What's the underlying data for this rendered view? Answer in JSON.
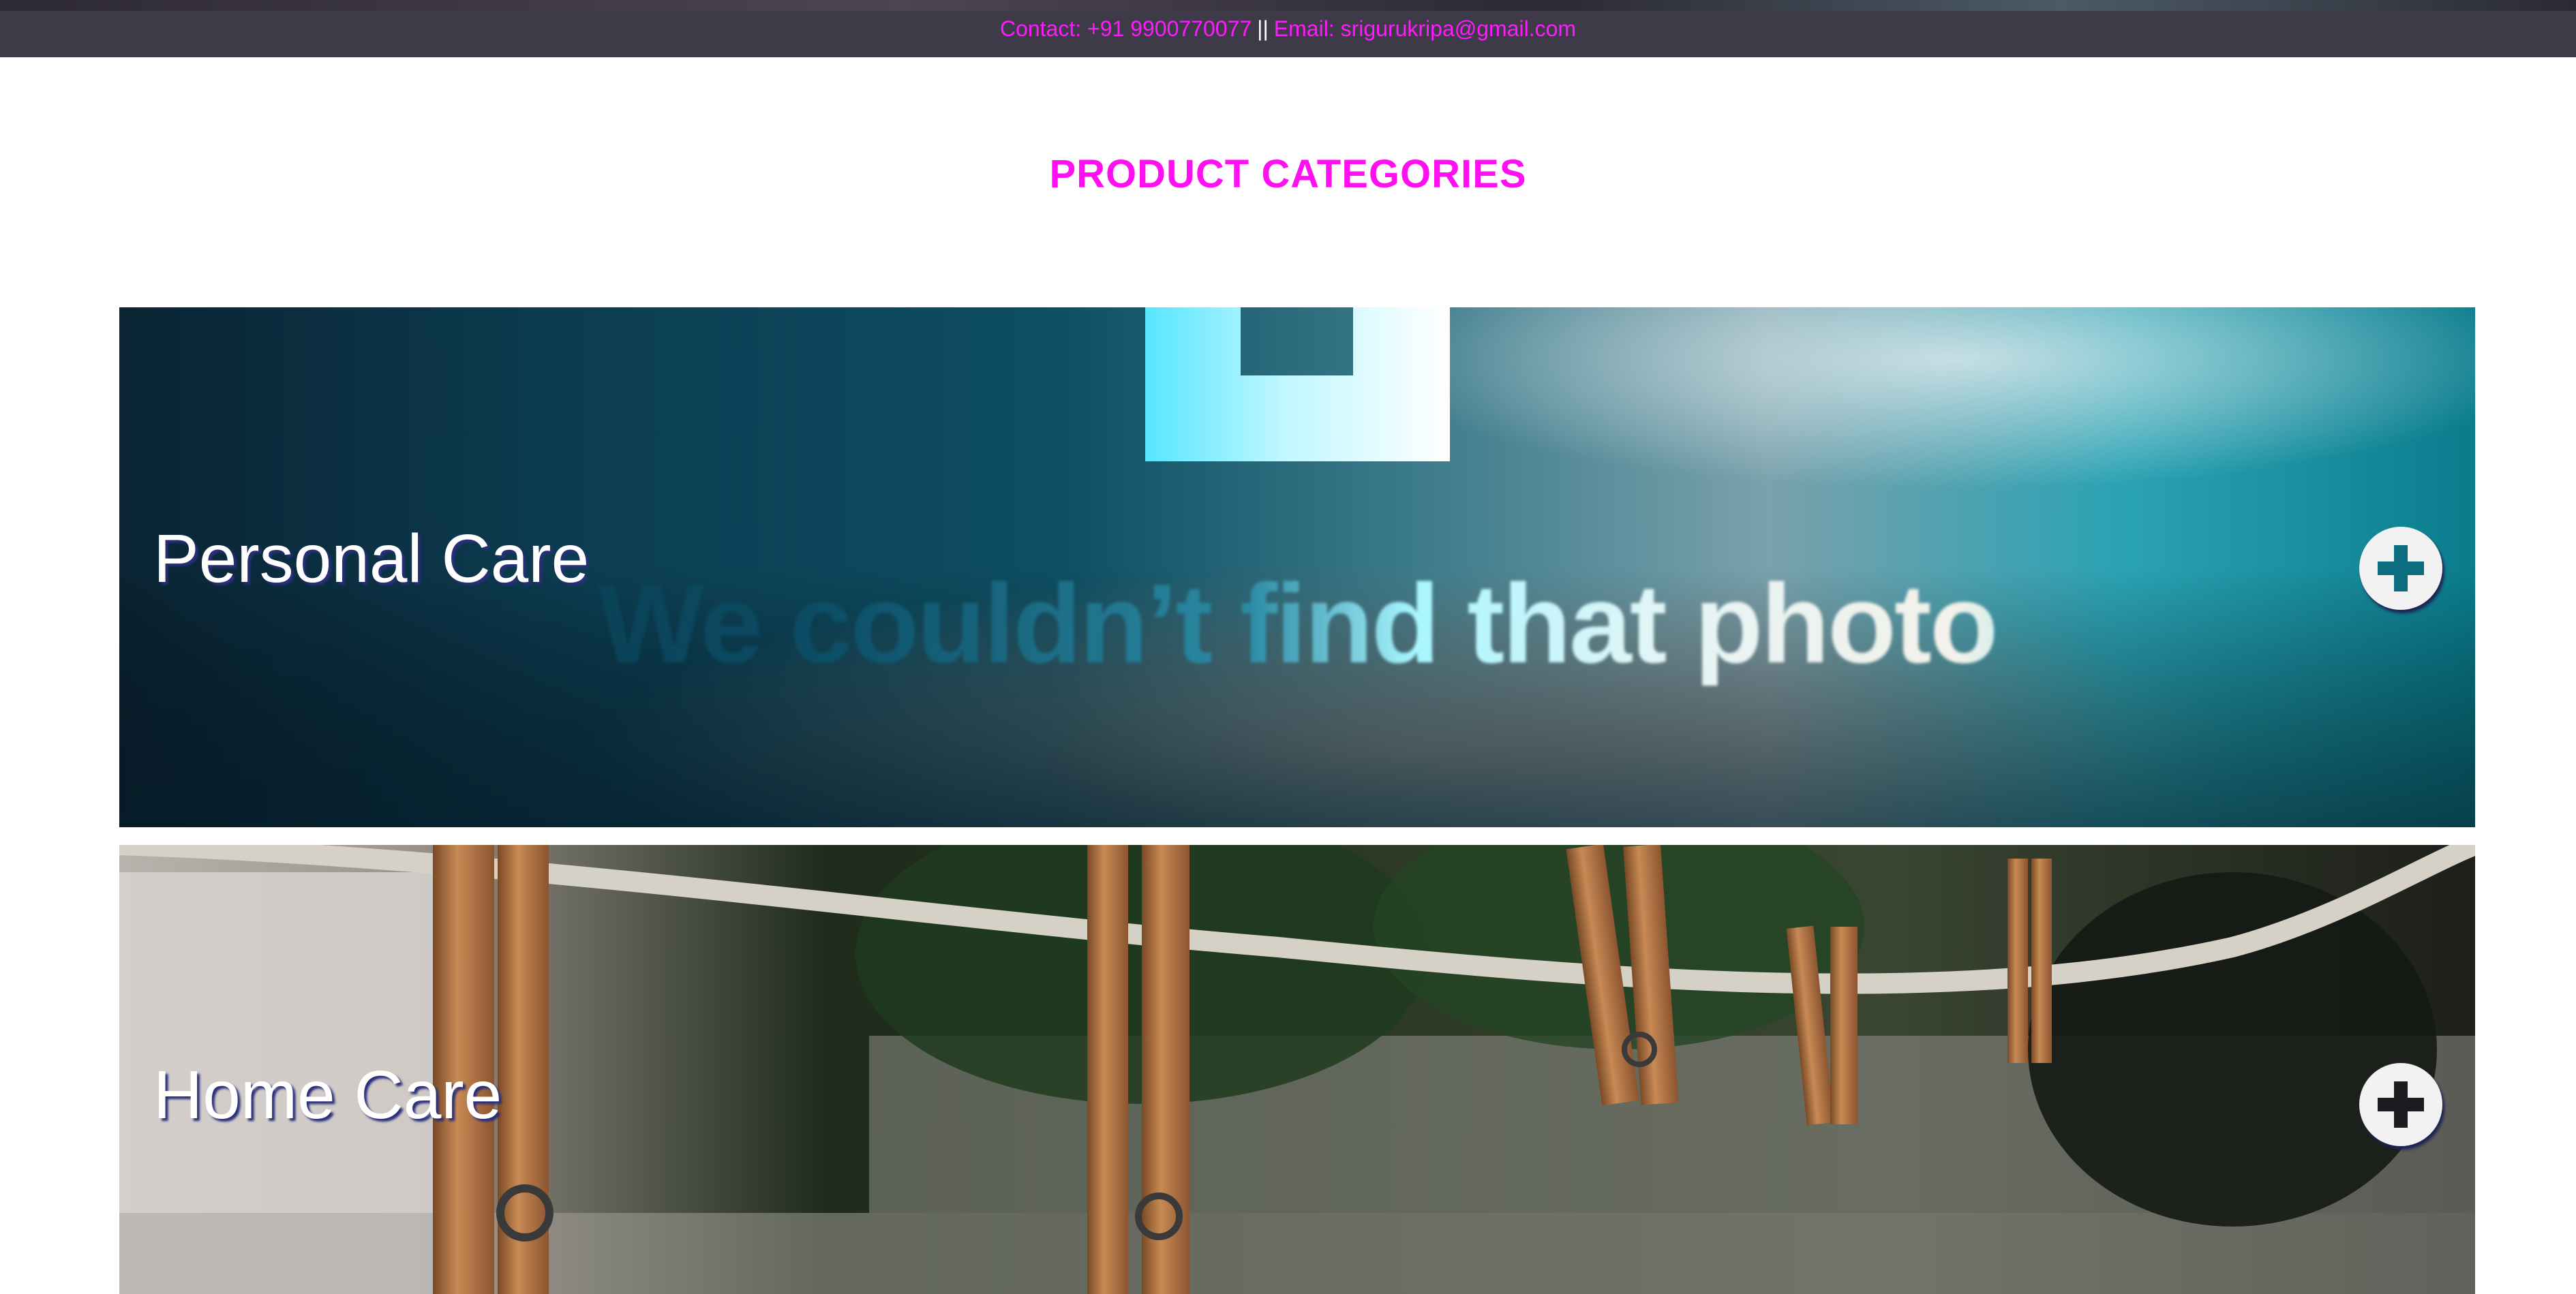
{
  "topbar": {
    "contact": "Contact: +91 9900770077",
    "separator": "||",
    "email": "Email: srigurukripa@gmail.com"
  },
  "page": {
    "title": "PRODUCT CATEGORIES"
  },
  "categories": [
    {
      "label": "Personal Care",
      "image_text": "We couldn’t find that photo",
      "button_icon": "plus-circle-icon"
    },
    {
      "label": "Home Care",
      "button_icon": "plus-circle-icon"
    }
  ],
  "colors": {
    "accent": "#ff10f0",
    "topbar_bg": "#3e3a48"
  }
}
